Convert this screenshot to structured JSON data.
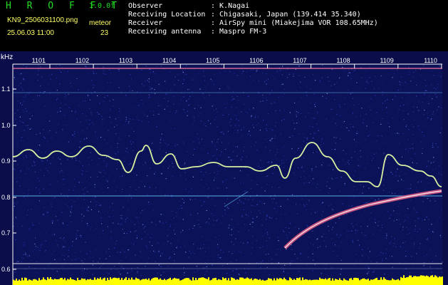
{
  "header": {
    "app_title": "H R O F F T",
    "version": "1.0.0f",
    "file_name": "KN9_2506031100.png",
    "meteor_label": "meteor",
    "timestamp": "25.06.03 11:00",
    "meteor_count": "23",
    "info": [
      {
        "key": "Observer",
        "value": ": K.Nagai"
      },
      {
        "key": "Receiving Location",
        "value": ": Chigasaki, Japan (139.414 35.340)"
      },
      {
        "key": "Receiver",
        "value": ": AirSpy mini (Miakejima VOR 108.65MHz)"
      },
      {
        "key": "Receiving antenna",
        "value": ": Maspro FM-3"
      }
    ]
  },
  "spectrogram": {
    "unit_label": "kHz",
    "x_ticks": [
      "1101",
      "1102",
      "1103",
      "1104",
      "1105",
      "1106",
      "1107",
      "1108",
      "1109",
      "1110"
    ],
    "y_ticks": [
      "1.1",
      "1.0",
      "0.9",
      "0.8",
      "0.7",
      "0.6"
    ],
    "colors": {
      "background": "#0a0d4a",
      "axis": "#ffffff",
      "trace": "#d8f0a0",
      "meteor": "#ff6688",
      "power_bar": "#ffff00",
      "cyan_line": "#66ccff"
    }
  }
}
